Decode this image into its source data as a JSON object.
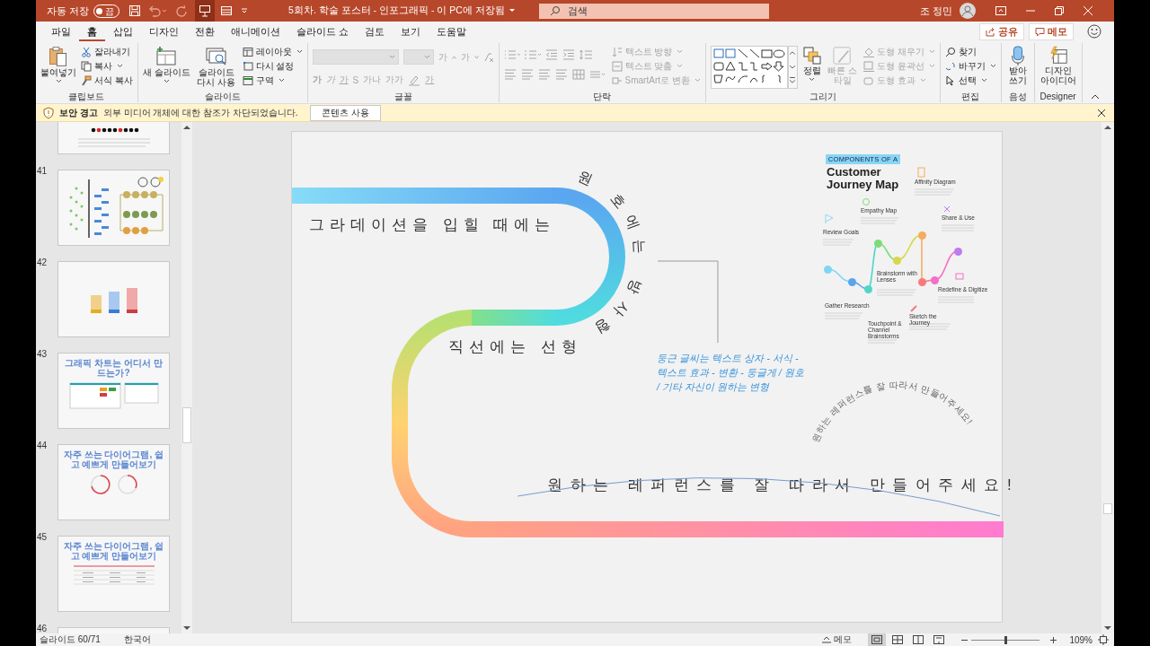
{
  "title_bar": {
    "autosave_label": "자동 저장",
    "autosave_state": "끔",
    "autosave_on": false,
    "document_title": "5회차. 학술 포스터 - 인포그래픽 - 이 PC에 저장됨",
    "search_placeholder": "검색",
    "user_name": "조 정민"
  },
  "tabs": [
    {
      "label": "파일",
      "selected": false
    },
    {
      "label": "홈",
      "selected": true
    },
    {
      "label": "삽입",
      "selected": false
    },
    {
      "label": "디자인",
      "selected": false
    },
    {
      "label": "전환",
      "selected": false
    },
    {
      "label": "애니메이션",
      "selected": false
    },
    {
      "label": "슬라이드 쇼",
      "selected": false
    },
    {
      "label": "검토",
      "selected": false
    },
    {
      "label": "보기",
      "selected": false
    },
    {
      "label": "도움말",
      "selected": false
    }
  ],
  "share_button": "공유",
  "comments_button": "메모",
  "ribbon": {
    "clipboard": {
      "label": "클립보드",
      "paste": "붙여넣기",
      "cut": "잘라내기",
      "copy": "복사",
      "format_painter": "서식 복사"
    },
    "slides": {
      "label": "슬라이드",
      "new_slide": "새 슬라이드",
      "reuse": "슬라이드 다시 사용",
      "layout": "레이아웃",
      "reset": "다시 설정",
      "section": "구역"
    },
    "font": {
      "label": "글꼴",
      "disabled": true,
      "grow": "가",
      "shrink": "가",
      "bold": "가",
      "italic": "가",
      "underline": "가",
      "strike": "S",
      "spacing": "가나",
      "case": "가가",
      "font_color": "가"
    },
    "paragraph": {
      "label": "단락",
      "disabled": true,
      "text_direction": "텍스트 방향",
      "align_text": "텍스트 맞춤",
      "smartart": "SmartArt로 변환"
    },
    "drawing": {
      "label": "그리기",
      "arrange": "정렬",
      "quick_styles": "빠른 스타일",
      "fill": "도형 채우기",
      "outline": "도형 윤곽선",
      "effects": "도형 효과",
      "styles_disabled": true
    },
    "editing": {
      "label": "편집",
      "find": "찾기",
      "replace": "바꾸기",
      "select": "선택"
    },
    "voice": {
      "label": "음성",
      "dictate": "받아쓰기"
    },
    "designer": {
      "label": "Designer",
      "ideas": "디자인 아이디어"
    }
  },
  "security_bar": {
    "title": "보안 경고",
    "message": "외부 미디어 개체에 대한 참조가 차단되었습니다.",
    "button": "콘텐츠 사용"
  },
  "thumbnails": [
    {
      "kind": "text-dots"
    },
    {
      "number": "41",
      "kind": "flowchart"
    },
    {
      "number": "42",
      "kind": "chart"
    },
    {
      "number": "43",
      "kind": "screens",
      "title": "그래픽 차트는 어디서 만드는가?"
    },
    {
      "number": "44",
      "kind": "rings",
      "title": "자주 쓰는 다이어그램, 쉽고 예쁘게 만들어보기"
    },
    {
      "number": "45",
      "kind": "table",
      "title": "자주 쓰는 다이어그램, 쉽고 예쁘게 만들어보기"
    },
    {
      "number": "46",
      "kind": "blank"
    }
  ],
  "slide": {
    "top_caption": "그라데이션을 입힐 때에는",
    "arc_caption": "원 호에는 방사형",
    "line_caption": "직선에는 선형",
    "note": "둥근 글씨는 텍스트 상자 - 서식 -\n텍스트 효과 - 변환 - 둥글게 / 원호\n/ 기타 자신이 원하는 변형",
    "bottom_caption": "원하는 레퍼런스를 잘 따라서 만들어주세요!",
    "arc_text": "원하는 레퍼런스를 잘 따라서 만들어주세요!",
    "infographic": {
      "kicker": "COMPONENTS OF A",
      "title": "Customer Journey Map",
      "steps": [
        {
          "label": "Affinity Diagram",
          "color": "#f6ac5e"
        },
        {
          "label": "Empathy Map",
          "color": "#7ddc7a"
        },
        {
          "label": "Share & Use",
          "color": "#c07af0"
        },
        {
          "label": "Review Goals",
          "color": "#7fd6f2"
        },
        {
          "label": "Brainstorm with Lenses",
          "color": "#d6d84a"
        },
        {
          "label": "Redefine & Digitize",
          "color": "#f46fc6"
        },
        {
          "label": "Gather Research",
          "color": "#5aa6ea"
        },
        {
          "label": "Sketch the Journey",
          "color": "#f77a7a"
        },
        {
          "label": "Touchpoint & Channel Brainstorms",
          "color": "#4fd6c9"
        }
      ]
    }
  },
  "status_bar": {
    "slide_counter": "슬라이드 60/71",
    "language": "한국어",
    "notes_button": "메모",
    "views": [
      {
        "selected": true
      },
      {
        "selected": false
      },
      {
        "selected": false
      },
      {
        "selected": false
      }
    ],
    "zoom": {
      "level": 0.5,
      "reading": "109%"
    }
  }
}
